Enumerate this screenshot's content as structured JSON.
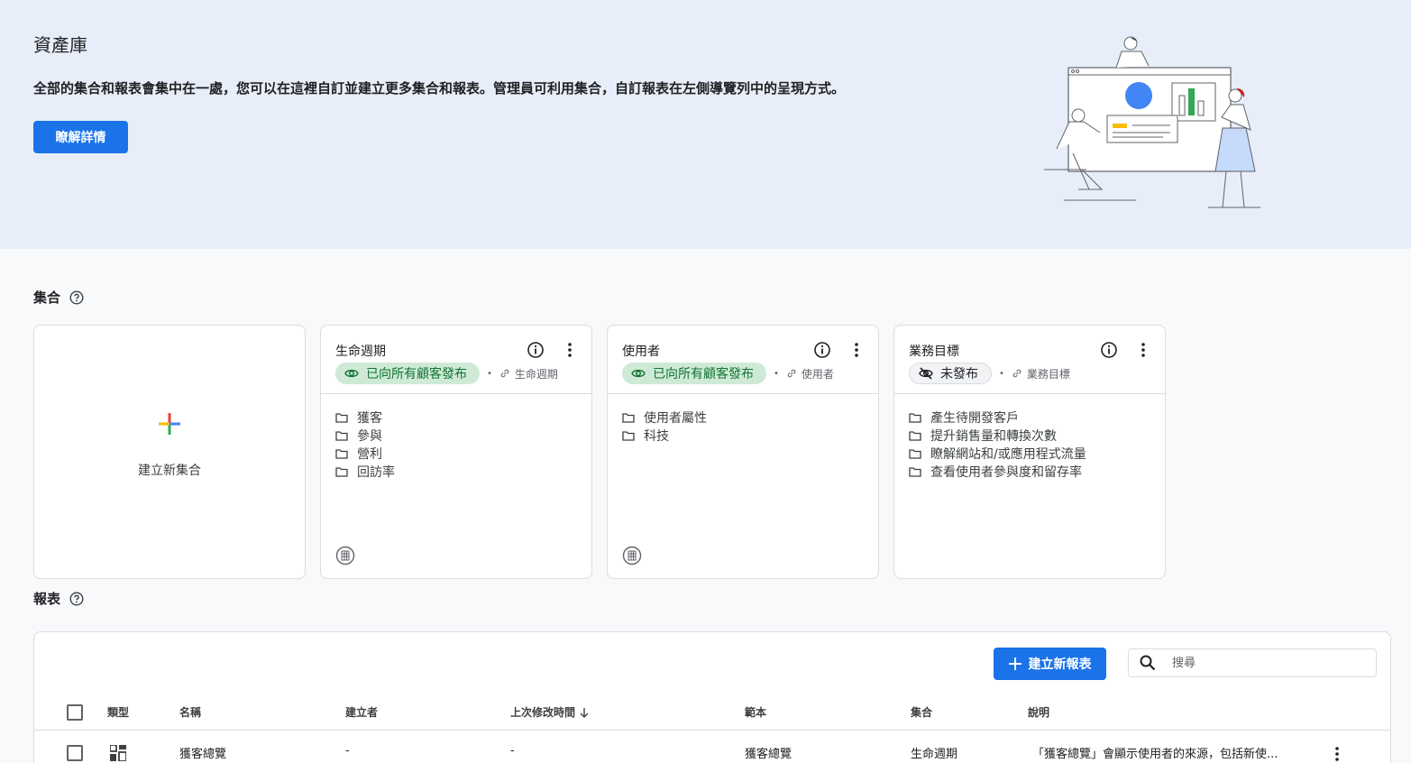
{
  "hero": {
    "title": "資產庫",
    "description": "全部的集合和報表會集中在一處，您可以在這裡自訂並建立更多集合和報表。管理員可利用集合，自訂報表在左側導覽列中的呈現方式。",
    "learn_more_label": "瞭解詳情"
  },
  "collections": {
    "section_title": "集合",
    "create_label": "建立新集合",
    "cards": [
      {
        "title": "生命週期",
        "status": "已向所有顧客發布",
        "status_type": "published",
        "template": "生命週期",
        "topics": [
          "獲客",
          "參與",
          "營利",
          "回訪率"
        ]
      },
      {
        "title": "使用者",
        "status": "已向所有顧客發布",
        "status_type": "published",
        "template": "使用者",
        "topics": [
          "使用者屬性",
          "科技"
        ]
      },
      {
        "title": "業務目標",
        "status": "未發布",
        "status_type": "unpublished",
        "template": "業務目標",
        "topics": [
          "產生待開發客戶",
          "提升銷售量和轉換次數",
          "瞭解網站和/或應用程式流量",
          "查看使用者參與度和留存率"
        ]
      }
    ]
  },
  "reports": {
    "section_title": "報表",
    "create_label": "建立新報表",
    "search_placeholder": "搜尋",
    "columns": {
      "type": "類型",
      "name": "名稱",
      "creator": "建立者",
      "last_modified": "上次修改時間",
      "template": "範本",
      "collection": "集合",
      "description": "說明"
    },
    "rows": [
      {
        "type_icon": "overview-icon",
        "name": "獲客總覽",
        "creator": "-",
        "last_modified": "-",
        "template": "獲客總覽",
        "collection": "生命週期",
        "description": "「獲客總覽」會顯示使用者的來源，包括新使..."
      }
    ]
  },
  "colors": {
    "primary": "#1a73e8",
    "hero_bg": "#e8eef9",
    "published_bg": "#ceead6",
    "published_text": "#137333"
  }
}
